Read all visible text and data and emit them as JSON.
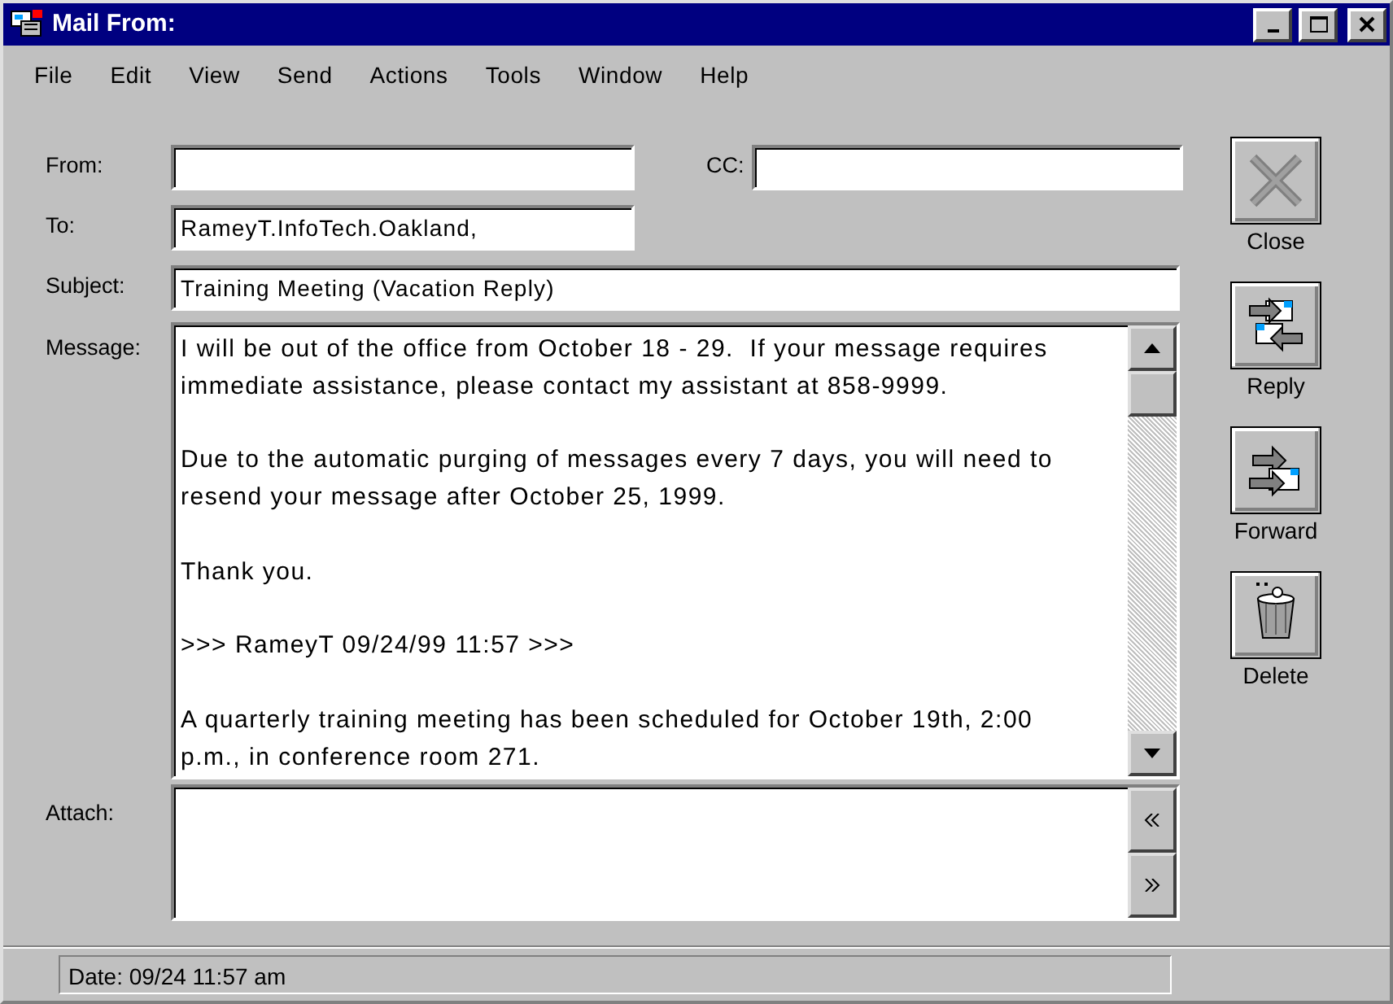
{
  "window": {
    "title": "Mail From:"
  },
  "menu": [
    {
      "label": "File"
    },
    {
      "label": "Edit"
    },
    {
      "label": "View"
    },
    {
      "label": "Send"
    },
    {
      "label": "Actions"
    },
    {
      "label": "Tools"
    },
    {
      "label": "Window"
    },
    {
      "label": "Help"
    }
  ],
  "from": {
    "label": "From:"
  },
  "cc": {
    "label": "CC:"
  },
  "to": {
    "label": "To:",
    "value": "RameyT.InfoTech.Oakland,"
  },
  "subject": {
    "label": "Subject:",
    "value": "Training Meeting (Vacation Reply)"
  },
  "message": {
    "label": "Message:",
    "paragraphs": [
      [
        "I will be out of the office from October 18 - 29.  If your message requires",
        "immediate assistance, please contact my assistant at 858-9999."
      ],
      [
        "Due to the automatic purging of messages every 7 days, you will need to",
        "resend your message after October 25, 1999."
      ],
      [
        "Thank you."
      ],
      [
        ">>> RameyT 09/24/99 11:57 >>>"
      ],
      [
        "A quarterly training meeting has been scheduled for October 19th, 2:00",
        "p.m., in conference room 271."
      ]
    ]
  },
  "attach": {
    "label": "Attach:"
  },
  "actions": [
    {
      "kind": "close",
      "label": "Close"
    },
    {
      "kind": "reply",
      "label": "Reply"
    },
    {
      "kind": "forward",
      "label": "Forward"
    },
    {
      "kind": "delete",
      "label": "Delete"
    }
  ],
  "status_bar": {
    "text": "Date: 09/24 11:57 am"
  }
}
